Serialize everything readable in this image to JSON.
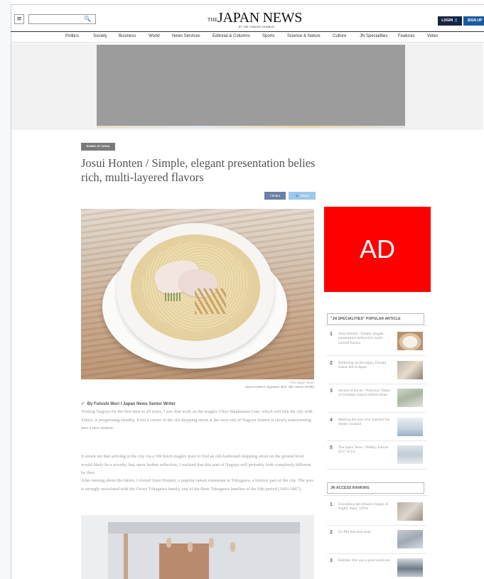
{
  "header": {
    "menu_glyph": "≡",
    "search_glyph": "🔍",
    "logo_the": "THE",
    "logo_main": "JAPAN NEWS",
    "logo_sub": "BY THE YOMIURI SHIMBUN",
    "login_label": "LOGIN 👤",
    "signup_label": "SIGN UP"
  },
  "nav": [
    "Politics",
    "Society",
    "Business",
    "World",
    "News Services",
    "Editorial & Columns",
    "Sports",
    "Science & Nature",
    "Culture",
    "JN Specialities",
    "Features",
    "Video"
  ],
  "article": {
    "tag": "RAMEN OF JAPAN",
    "headline": "Josui Honten / Simple, elegant presentation belies rich, multi-layered flavors",
    "share_fb": "f Share",
    "share_tw": "🐦 Tweet",
    "photo_credit": "The Japan News",
    "photo_caption": "Josui Honten's signature dish, shio ramen (¥780)",
    "byline_icon": "✐",
    "byline": "By Futoshi Mori / Japan News Senior Writer",
    "paragraphs": [
      "Visiting Nagoya for the first time in 20 years, I saw that work on the maglev Chuo Shinkansen Line, which will link the city with Tokyo, is progressing steadily. Even a corner of the old shopping street at the west exit of Nagoya Station is slowly transforming into a new station.",
      "It struck me that arriving in the city via a 500 km/h maglev train to find an old-fashioned shopping street on the ground level would likely be a novelty, but, upon further reflection, I realized that this part of Nagoya will probably look completely different by then.",
      "After musing about the future, I visited Josui Honten, a popular ramen restaurant in Tokugawa, a historic part of the city. The area is strongly associated with the Owari Tokugawa family, one of the three Tokugawa families of the Edo period (1603-1867)."
    ]
  },
  "sidebar": {
    "ad_label": "AD",
    "popular_heading": "\"JN SPECIALITIES\" POPULAR ARTICLE",
    "popular": [
      {
        "num": "1",
        "text": "Josui Honten / Simple, elegant presentation belies rich, multi-layered flavors"
      },
      {
        "num": "2",
        "text": "Reflecting on the legacy Donald Keene left in Japan"
      },
      {
        "num": "3",
        "text": "Secrets of Kyoto / Nanzenji: Name of Christian church reflects times"
      },
      {
        "num": "4",
        "text": "Meeting the man who 'married' his dream vocaloid"
      },
      {
        "num": "5",
        "text": "The Japan News / Weekly Edition (6/17-6/23)"
      }
    ],
    "ranking_heading": "JN ACCESS RANKING",
    "ranking": [
      {
        "num": "1",
        "text": "Fukushima lab releases images of 'highly likely' UFOs"
      },
      {
        "num": "2",
        "text": "Ex-PM Abe shot dead"
      },
      {
        "num": "3",
        "text": "Kishida: Abe was a great politician"
      }
    ]
  },
  "colors": {
    "ad_red": "#ff0000",
    "login_bg": "#17233f",
    "signup_bg": "#1a5b9e",
    "banner_gray": "#9c9c9c"
  }
}
